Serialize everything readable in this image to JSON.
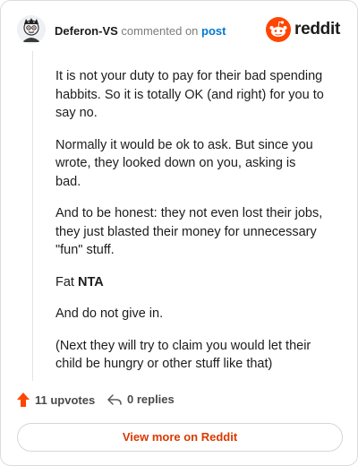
{
  "header": {
    "username": "Deferon-VS",
    "action_text": "commented on",
    "post_link": "post",
    "brand_name": "reddit"
  },
  "comment": {
    "paragraphs": [
      "It is not your duty to pay for their bad spending habbits. So it is totally OK (and right) for you to say no.",
      "Normally it would be ok to ask. But since you wrote, they looked down on you, asking is bad.",
      "And to be honest: they not even lost their jobs, they just blasted their money for unnecessary \"fun\" stuff.",
      "And do not give in.",
      "(Next they will try to claim you would let their child be hungry or other stuff like that)"
    ],
    "verdict_prefix": "Fat",
    "verdict": "NTA"
  },
  "footer": {
    "upvotes_label": "11 upvotes",
    "replies_label": "0 replies",
    "view_more_label": "View more on Reddit"
  },
  "colors": {
    "accent": "#ff4500",
    "link": "#0079d3",
    "view_more": "#d93a00"
  },
  "icons": {
    "upvote": "upvote-arrow-icon",
    "reply": "reply-arrow-icon",
    "brand": "reddit-snoo-icon"
  }
}
